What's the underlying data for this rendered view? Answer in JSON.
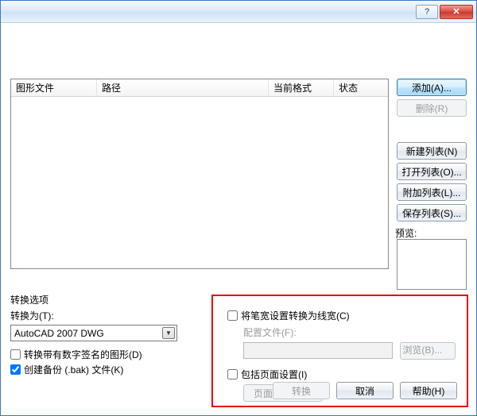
{
  "titlebar": {
    "help": "?",
    "close": "✕"
  },
  "table": {
    "headers": {
      "file": "图形文件",
      "path": "路径",
      "format": "当前格式",
      "status": "状态"
    }
  },
  "buttons": {
    "add": "添加(A)...",
    "remove": "删除(R)",
    "newList": "新建列表(N)",
    "openList": "打开列表(O)...",
    "appendList": "附加列表(L)...",
    "saveList": "保存列表(S)..."
  },
  "preview": {
    "label": "预览:"
  },
  "convert": {
    "sectionLabel": "转换选项",
    "convertToLabel": "转换为(T):",
    "convertToValue": "AutoCAD 2007 DWG",
    "signedLabel": "转换带有数字签名的图形(D)",
    "backupLabel": "创建备份 (.bak) 文件(K)"
  },
  "right": {
    "penwidth": "将笔宽设置转换为线宽(C)",
    "configLabel": "配置文件(F):",
    "browse": "浏览(B)...",
    "includePage": "包括页面设置(I)",
    "pageSetup": "页面设置(P)..."
  },
  "footer": {
    "convert": "转换",
    "cancel": "取消",
    "help": "帮助(H)"
  },
  "checks": {
    "signed": false,
    "backup": true,
    "penwidth": false,
    "includePage": false
  }
}
